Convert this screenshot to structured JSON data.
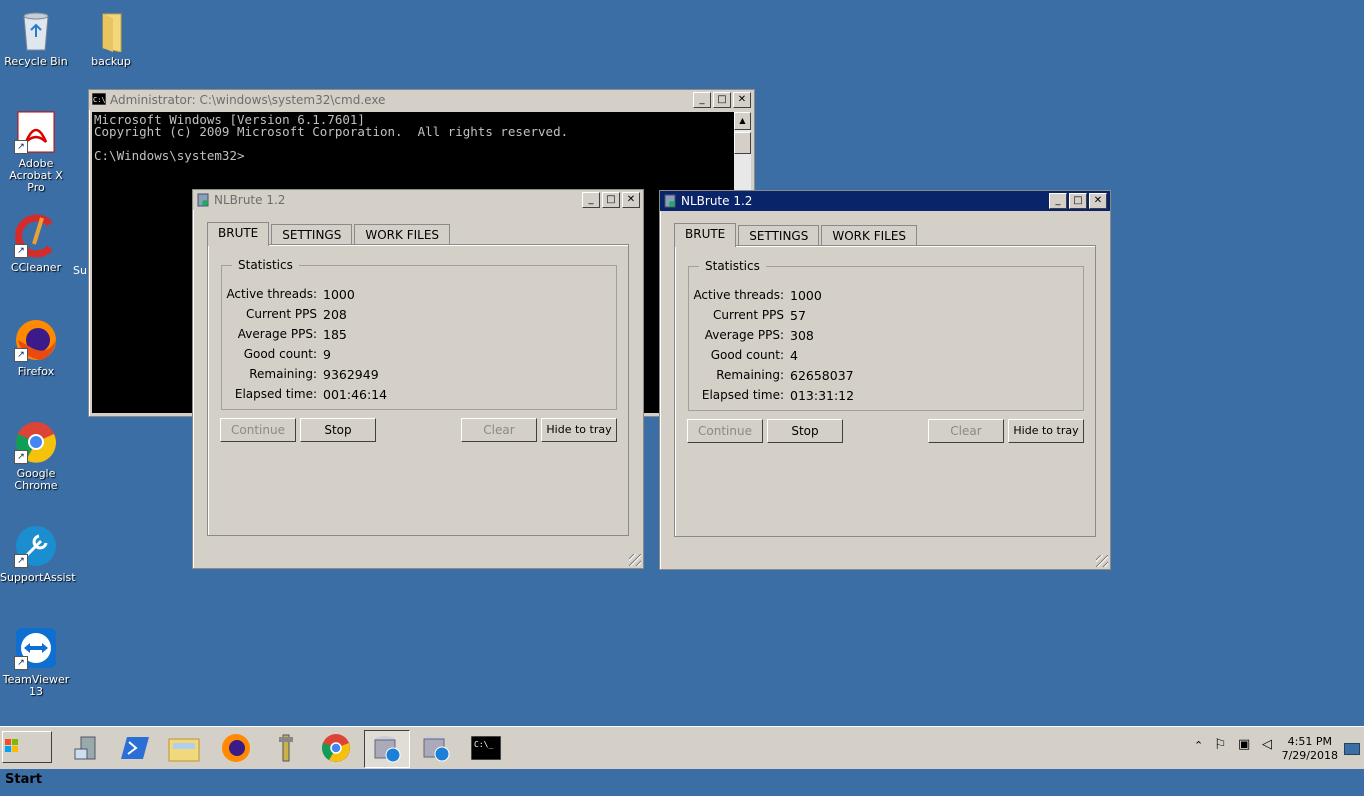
{
  "desktop": {
    "icons": [
      {
        "label": "Recycle Bin",
        "icon": "recycle-bin-icon"
      },
      {
        "label": "backup",
        "icon": "folder-icon"
      },
      {
        "label": "Adobe Acrobat X Pro",
        "icon": "acrobat-icon"
      },
      {
        "label": "CCleaner",
        "icon": "ccleaner-icon"
      },
      {
        "label": "Firefox",
        "icon": "firefox-icon"
      },
      {
        "label": "Google Chrome",
        "icon": "chrome-icon"
      },
      {
        "label": "SupportAssist",
        "icon": "supportassist-icon"
      },
      {
        "label": "TeamViewer 13",
        "icon": "teamviewer-icon"
      }
    ],
    "partial_label": "Su"
  },
  "cmd": {
    "title": "Administrator: C:\\windows\\system32\\cmd.exe",
    "lines": "Microsoft Windows [Version 6.1.7601]\nCopyright (c) 2009 Microsoft Corporation.  All rights reserved.\n\nC:\\Windows\\system32>"
  },
  "nlbrute_labels": {
    "tabs": [
      "BRUTE",
      "SETTINGS",
      "WORK FILES"
    ],
    "group": "Statistics",
    "active_threads": "Active threads:",
    "current_pps": "Current PPS",
    "average_pps": "Average PPS:",
    "good_count": "Good count:",
    "remaining": "Remaining:",
    "elapsed": "Elapsed time:",
    "continue": "Continue",
    "stop": "Stop",
    "clear": "Clear",
    "hide": "Hide to tray"
  },
  "win1": {
    "title": "NLBrute 1.2",
    "active_threads": "1000",
    "current_pps": "208",
    "average_pps": "185",
    "good_count": "9",
    "remaining": "9362949",
    "elapsed": "001:46:14"
  },
  "win2": {
    "title": "NLBrute 1.2",
    "active_threads": "1000",
    "current_pps": "57",
    "average_pps": "308",
    "good_count": "4",
    "remaining": "62658037",
    "elapsed": "013:31:12"
  },
  "taskbar": {
    "start": "Start",
    "items": [
      "server-manager-icon",
      "powershell-icon",
      "explorer-icon",
      "firefox-icon",
      "tools-icon",
      "chrome-icon",
      "nlbrute-icon",
      "nlbrute-icon",
      "cmd-icon"
    ],
    "time": "4:51 PM",
    "date": "7/29/2018"
  },
  "colors": {
    "desktop": "#3a6ea5",
    "active_title": "#0a246a",
    "window": "#d4d0c8"
  }
}
